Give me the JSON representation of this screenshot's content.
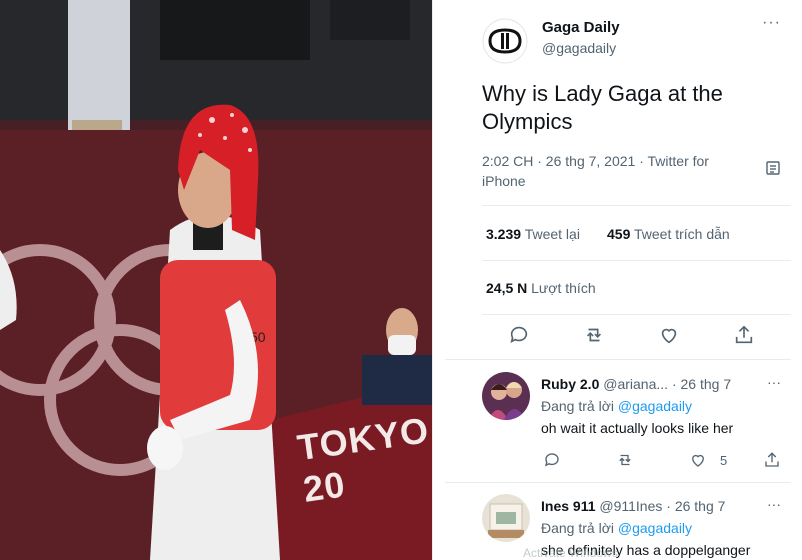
{
  "photo": {
    "banner_text": "TOKYO 20",
    "bib_number": "50"
  },
  "tweet": {
    "name": "Gaga Daily",
    "handle": "@gagadaily",
    "text": "Why is Lady Gaga at the Olympics",
    "meta": "2:02 CH · 26 thg 7, 2021 · Twitter for iPhone",
    "retweets_count": "3.239",
    "retweets_label": "Tweet lại",
    "quotes_count": "459",
    "quotes_label": "Tweet trích dẫn",
    "likes_count": "24,5 N",
    "likes_label": "Lượt thích",
    "more": "···"
  },
  "replies": [
    {
      "name": "Ruby 2.0",
      "handle": "@ariana...",
      "date": "· 26 thg 7",
      "replying_prefix": "Đang trả lời",
      "replying_to": "@gagadaily",
      "text": "oh wait it actually looks like her",
      "likes": "5"
    },
    {
      "name": "Ines 911",
      "handle": "@911Ines",
      "date": "· 26 thg 7",
      "replying_prefix": "Đang trả lời",
      "replying_to": "@gagadaily",
      "text": "she definitely has a doppelganger"
    }
  ],
  "watermark": "Activate Windows"
}
